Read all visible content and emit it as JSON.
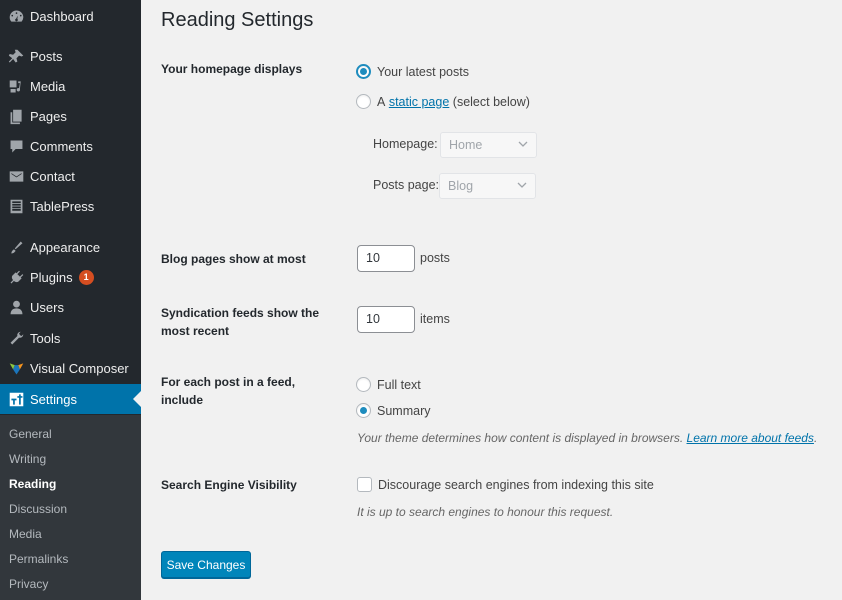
{
  "sidebar": {
    "items": [
      {
        "label": "Dashboard",
        "icon": "dashboard-icon"
      },
      {
        "label": "Posts",
        "icon": "pin-icon"
      },
      {
        "label": "Media",
        "icon": "media-icon"
      },
      {
        "label": "Pages",
        "icon": "pages-icon"
      },
      {
        "label": "Comments",
        "icon": "comment-icon"
      },
      {
        "label": "Contact",
        "icon": "envelope-icon"
      },
      {
        "label": "TablePress",
        "icon": "table-icon"
      },
      {
        "label": "Appearance",
        "icon": "paintbrush-icon"
      },
      {
        "label": "Plugins",
        "icon": "plug-icon",
        "badge": "1"
      },
      {
        "label": "Users",
        "icon": "user-icon"
      },
      {
        "label": "Tools",
        "icon": "wrench-icon"
      },
      {
        "label": "Visual Composer",
        "icon": "visual-composer-icon"
      },
      {
        "label": "Settings",
        "icon": "settings-icon",
        "active": true
      }
    ],
    "submenu": [
      {
        "label": "General"
      },
      {
        "label": "Writing"
      },
      {
        "label": "Reading",
        "current": true
      },
      {
        "label": "Discussion"
      },
      {
        "label": "Media"
      },
      {
        "label": "Permalinks"
      },
      {
        "label": "Privacy"
      }
    ]
  },
  "page": {
    "title": "Reading Settings",
    "homepage_displays": {
      "label": "Your homepage displays",
      "option_latest": "Your latest posts",
      "option_static_prefix": "A",
      "option_static_link": "static page",
      "option_static_suffix": "(select below)",
      "selected": "latest",
      "homepage_label": "Homepage:",
      "homepage_value": "Home",
      "posts_page_label": "Posts page:",
      "posts_page_value": "Blog"
    },
    "blog_pages": {
      "label": "Blog pages show at most",
      "value": "10",
      "unit": "posts"
    },
    "syndication": {
      "label": "Syndication feeds show the most recent",
      "value": "10",
      "unit": "items"
    },
    "feed_include": {
      "label": "For each post in a feed, include",
      "option_full": "Full text",
      "option_summary": "Summary",
      "selected": "summary",
      "description": "Your theme determines how content is displayed in browsers.",
      "description_link": "Learn more about feeds",
      "description_end": "."
    },
    "search_engine": {
      "label": "Search Engine Visibility",
      "checkbox_label": "Discourage search engines from indexing this site",
      "checked": false,
      "description": "It is up to search engines to honour this request."
    },
    "save_label": "Save Changes"
  },
  "colors": {
    "sidebar_bg": "#23282d",
    "submenu_bg": "#32373c",
    "accent": "#0073aa",
    "button": "#0085ba",
    "badge": "#d54e21",
    "page_bg": "#f1f1f1"
  }
}
